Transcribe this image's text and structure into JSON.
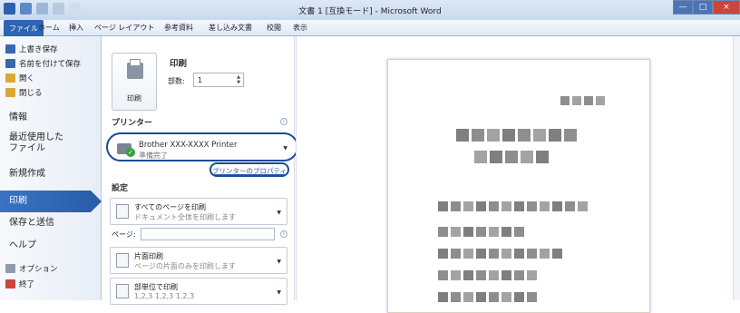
{
  "window": {
    "title": "文書 1 [互換モード] - Microsoft Word",
    "qat_colors": [
      "#2f5fad",
      "#5f88c8",
      "#9fb6d9",
      "#b9c9e0",
      "#d3dde9"
    ],
    "controls": [
      {
        "label": "—",
        "color": "#4c74b5"
      },
      {
        "label": "□",
        "color": "#4c74b5"
      },
      {
        "label": "×",
        "color": "#c9463d"
      }
    ]
  },
  "ribbon": {
    "tabs": [
      "ファイル",
      "ホーム",
      "挿入",
      "ページ レイアウト",
      "参考資料",
      "差し込み文書",
      "校閲",
      "表示"
    ],
    "active": "ファイル"
  },
  "backstage": {
    "small_items": [
      {
        "label": "上書き保存",
        "icon": "save-icon",
        "color": "#3a67b4"
      },
      {
        "label": "名前を付けて保存",
        "icon": "save-as-icon",
        "color": "#3a67b4"
      },
      {
        "label": "開く",
        "icon": "open-folder-icon",
        "color": "#d9a936"
      },
      {
        "label": "閉じる",
        "icon": "close-doc-icon",
        "color": "#d9a936"
      }
    ],
    "big_items": [
      "情報",
      "最近使用した\nファイル",
      "新規作成",
      "印刷",
      "保存と送信",
      "ヘルプ"
    ],
    "active": "印刷",
    "bottom_items": [
      {
        "label": "オプション",
        "icon": "options-icon",
        "color": "#8f9aab"
      },
      {
        "label": "終了",
        "icon": "exit-icon",
        "color": "#c9463d"
      }
    ]
  },
  "print_panel": {
    "heading": "印刷",
    "print_button": "印刷",
    "copies_label": "部数:",
    "copies_value": "1",
    "printer_heading": "プリンター",
    "printer_name": "Brother XXX-XXXX Printer",
    "printer_status": "準備完了",
    "printer_properties": "プリンターのプロパティ",
    "settings_heading": "設定",
    "settings": [
      {
        "title": "すべてのページを印刷",
        "subtitle": "ドキュメント全体を印刷します",
        "icon": "pages-icon"
      },
      {
        "title": "片面印刷",
        "subtitle": "ページの片面のみを印刷します",
        "icon": "one-sided-icon"
      },
      {
        "title": "部単位で印刷",
        "subtitle": "1,2,3    1,2,3    1,2,3",
        "icon": "collate-icon"
      }
    ],
    "pages_label": "ページ:",
    "pages_value": ""
  },
  "preview": {
    "rows": [
      {
        "count": 4,
        "colors": [
          "#8e8e8e",
          "#a3a3a3",
          "#8e8e8e",
          "#a3a3a3"
        ]
      },
      {
        "count": 8,
        "colors": [
          "#7f7f7f",
          "#8e8e8e",
          "#a3a3a3",
          "#7f7f7f",
          "#8e8e8e",
          "#a3a3a3",
          "#7f7f7f",
          "#8e8e8e"
        ]
      },
      {
        "count": 5,
        "colors": [
          "#a3a3a3",
          "#7f7f7f",
          "#8e8e8e",
          "#a3a3a3",
          "#7f7f7f"
        ]
      },
      {
        "count": 12,
        "colors": [
          "#7f7f7f",
          "#8e8e8e",
          "#a3a3a3",
          "#7f7f7f",
          "#8e8e8e",
          "#a3a3a3",
          "#7f7f7f",
          "#8e8e8e",
          "#a3a3a3",
          "#7f7f7f",
          "#8e8e8e",
          "#a3a3a3"
        ]
      },
      {
        "count": 7,
        "colors": [
          "#8e8e8e",
          "#a3a3a3",
          "#7f7f7f",
          "#8e8e8e",
          "#a3a3a3",
          "#7f7f7f",
          "#8e8e8e"
        ]
      },
      {
        "count": 10,
        "colors": [
          "#7f7f7f",
          "#8e8e8e",
          "#a3a3a3",
          "#7f7f7f",
          "#8e8e8e",
          "#a3a3a3",
          "#7f7f7f",
          "#8e8e8e",
          "#a3a3a3",
          "#7f7f7f"
        ]
      },
      {
        "count": 8,
        "colors": [
          "#8e8e8e",
          "#a3a3a3",
          "#7f7f7f",
          "#8e8e8e",
          "#a3a3a3",
          "#7f7f7f",
          "#8e8e8e",
          "#a3a3a3"
        ]
      },
      {
        "count": 8,
        "colors": [
          "#7f7f7f",
          "#8e8e8e",
          "#a3a3a3",
          "#7f7f7f",
          "#8e8e8e",
          "#a3a3a3",
          "#7f7f7f",
          "#8e8e8e"
        ]
      }
    ]
  }
}
